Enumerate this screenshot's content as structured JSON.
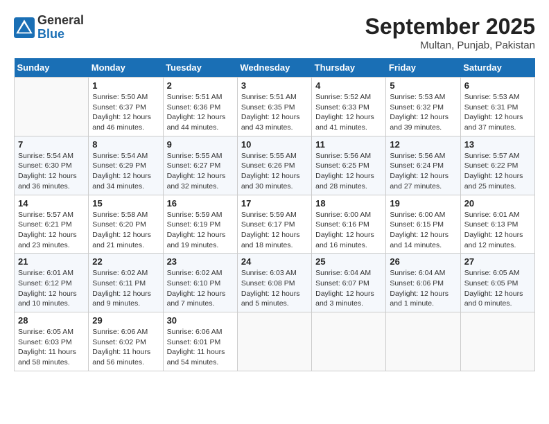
{
  "header": {
    "logo_general": "General",
    "logo_blue": "Blue",
    "month_title": "September 2025",
    "location": "Multan, Punjab, Pakistan"
  },
  "weekdays": [
    "Sunday",
    "Monday",
    "Tuesday",
    "Wednesday",
    "Thursday",
    "Friday",
    "Saturday"
  ],
  "weeks": [
    [
      {
        "day": "",
        "detail": ""
      },
      {
        "day": "1",
        "detail": "Sunrise: 5:50 AM\nSunset: 6:37 PM\nDaylight: 12 hours\nand 46 minutes."
      },
      {
        "day": "2",
        "detail": "Sunrise: 5:51 AM\nSunset: 6:36 PM\nDaylight: 12 hours\nand 44 minutes."
      },
      {
        "day": "3",
        "detail": "Sunrise: 5:51 AM\nSunset: 6:35 PM\nDaylight: 12 hours\nand 43 minutes."
      },
      {
        "day": "4",
        "detail": "Sunrise: 5:52 AM\nSunset: 6:33 PM\nDaylight: 12 hours\nand 41 minutes."
      },
      {
        "day": "5",
        "detail": "Sunrise: 5:53 AM\nSunset: 6:32 PM\nDaylight: 12 hours\nand 39 minutes."
      },
      {
        "day": "6",
        "detail": "Sunrise: 5:53 AM\nSunset: 6:31 PM\nDaylight: 12 hours\nand 37 minutes."
      }
    ],
    [
      {
        "day": "7",
        "detail": "Sunrise: 5:54 AM\nSunset: 6:30 PM\nDaylight: 12 hours\nand 36 minutes."
      },
      {
        "day": "8",
        "detail": "Sunrise: 5:54 AM\nSunset: 6:29 PM\nDaylight: 12 hours\nand 34 minutes."
      },
      {
        "day": "9",
        "detail": "Sunrise: 5:55 AM\nSunset: 6:27 PM\nDaylight: 12 hours\nand 32 minutes."
      },
      {
        "day": "10",
        "detail": "Sunrise: 5:55 AM\nSunset: 6:26 PM\nDaylight: 12 hours\nand 30 minutes."
      },
      {
        "day": "11",
        "detail": "Sunrise: 5:56 AM\nSunset: 6:25 PM\nDaylight: 12 hours\nand 28 minutes."
      },
      {
        "day": "12",
        "detail": "Sunrise: 5:56 AM\nSunset: 6:24 PM\nDaylight: 12 hours\nand 27 minutes."
      },
      {
        "day": "13",
        "detail": "Sunrise: 5:57 AM\nSunset: 6:22 PM\nDaylight: 12 hours\nand 25 minutes."
      }
    ],
    [
      {
        "day": "14",
        "detail": "Sunrise: 5:57 AM\nSunset: 6:21 PM\nDaylight: 12 hours\nand 23 minutes."
      },
      {
        "day": "15",
        "detail": "Sunrise: 5:58 AM\nSunset: 6:20 PM\nDaylight: 12 hours\nand 21 minutes."
      },
      {
        "day": "16",
        "detail": "Sunrise: 5:59 AM\nSunset: 6:19 PM\nDaylight: 12 hours\nand 19 minutes."
      },
      {
        "day": "17",
        "detail": "Sunrise: 5:59 AM\nSunset: 6:17 PM\nDaylight: 12 hours\nand 18 minutes."
      },
      {
        "day": "18",
        "detail": "Sunrise: 6:00 AM\nSunset: 6:16 PM\nDaylight: 12 hours\nand 16 minutes."
      },
      {
        "day": "19",
        "detail": "Sunrise: 6:00 AM\nSunset: 6:15 PM\nDaylight: 12 hours\nand 14 minutes."
      },
      {
        "day": "20",
        "detail": "Sunrise: 6:01 AM\nSunset: 6:13 PM\nDaylight: 12 hours\nand 12 minutes."
      }
    ],
    [
      {
        "day": "21",
        "detail": "Sunrise: 6:01 AM\nSunset: 6:12 PM\nDaylight: 12 hours\nand 10 minutes."
      },
      {
        "day": "22",
        "detail": "Sunrise: 6:02 AM\nSunset: 6:11 PM\nDaylight: 12 hours\nand 9 minutes."
      },
      {
        "day": "23",
        "detail": "Sunrise: 6:02 AM\nSunset: 6:10 PM\nDaylight: 12 hours\nand 7 minutes."
      },
      {
        "day": "24",
        "detail": "Sunrise: 6:03 AM\nSunset: 6:08 PM\nDaylight: 12 hours\nand 5 minutes."
      },
      {
        "day": "25",
        "detail": "Sunrise: 6:04 AM\nSunset: 6:07 PM\nDaylight: 12 hours\nand 3 minutes."
      },
      {
        "day": "26",
        "detail": "Sunrise: 6:04 AM\nSunset: 6:06 PM\nDaylight: 12 hours\nand 1 minute."
      },
      {
        "day": "27",
        "detail": "Sunrise: 6:05 AM\nSunset: 6:05 PM\nDaylight: 12 hours\nand 0 minutes."
      }
    ],
    [
      {
        "day": "28",
        "detail": "Sunrise: 6:05 AM\nSunset: 6:03 PM\nDaylight: 11 hours\nand 58 minutes."
      },
      {
        "day": "29",
        "detail": "Sunrise: 6:06 AM\nSunset: 6:02 PM\nDaylight: 11 hours\nand 56 minutes."
      },
      {
        "day": "30",
        "detail": "Sunrise: 6:06 AM\nSunset: 6:01 PM\nDaylight: 11 hours\nand 54 minutes."
      },
      {
        "day": "",
        "detail": ""
      },
      {
        "day": "",
        "detail": ""
      },
      {
        "day": "",
        "detail": ""
      },
      {
        "day": "",
        "detail": ""
      }
    ]
  ]
}
